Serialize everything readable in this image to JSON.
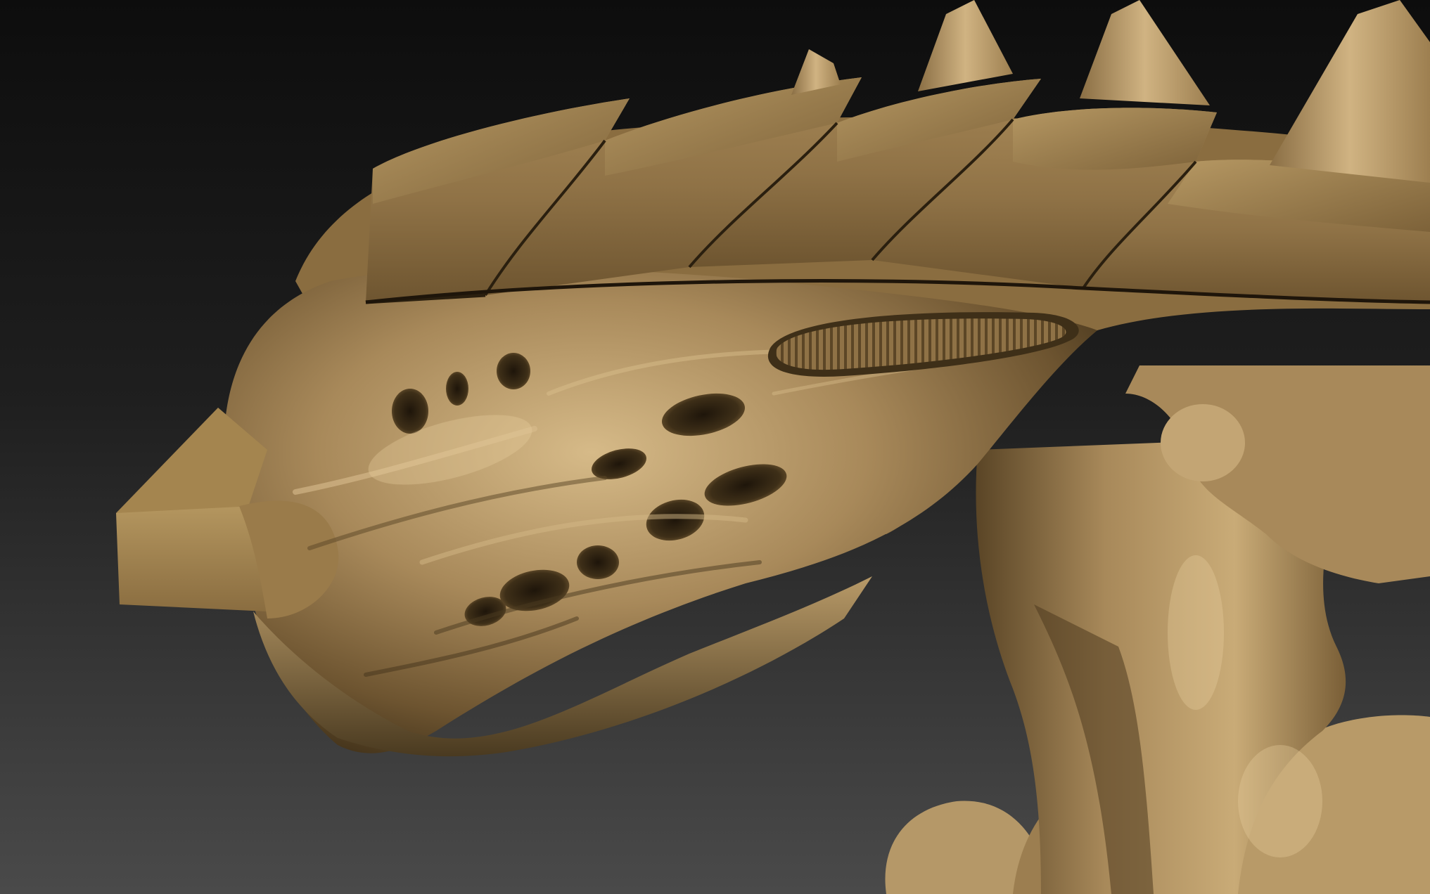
{
  "scene": {
    "background_top": "#0d0d0d",
    "background_bottom": "#4a4a4a",
    "material_base": "#a8895a",
    "material_light": "#d2b584",
    "material_mid": "#8f7246",
    "material_shadow": "#3e2f18",
    "material_deep": "#1e150a",
    "subject_icon": "creature-head-sculpt-icon"
  }
}
